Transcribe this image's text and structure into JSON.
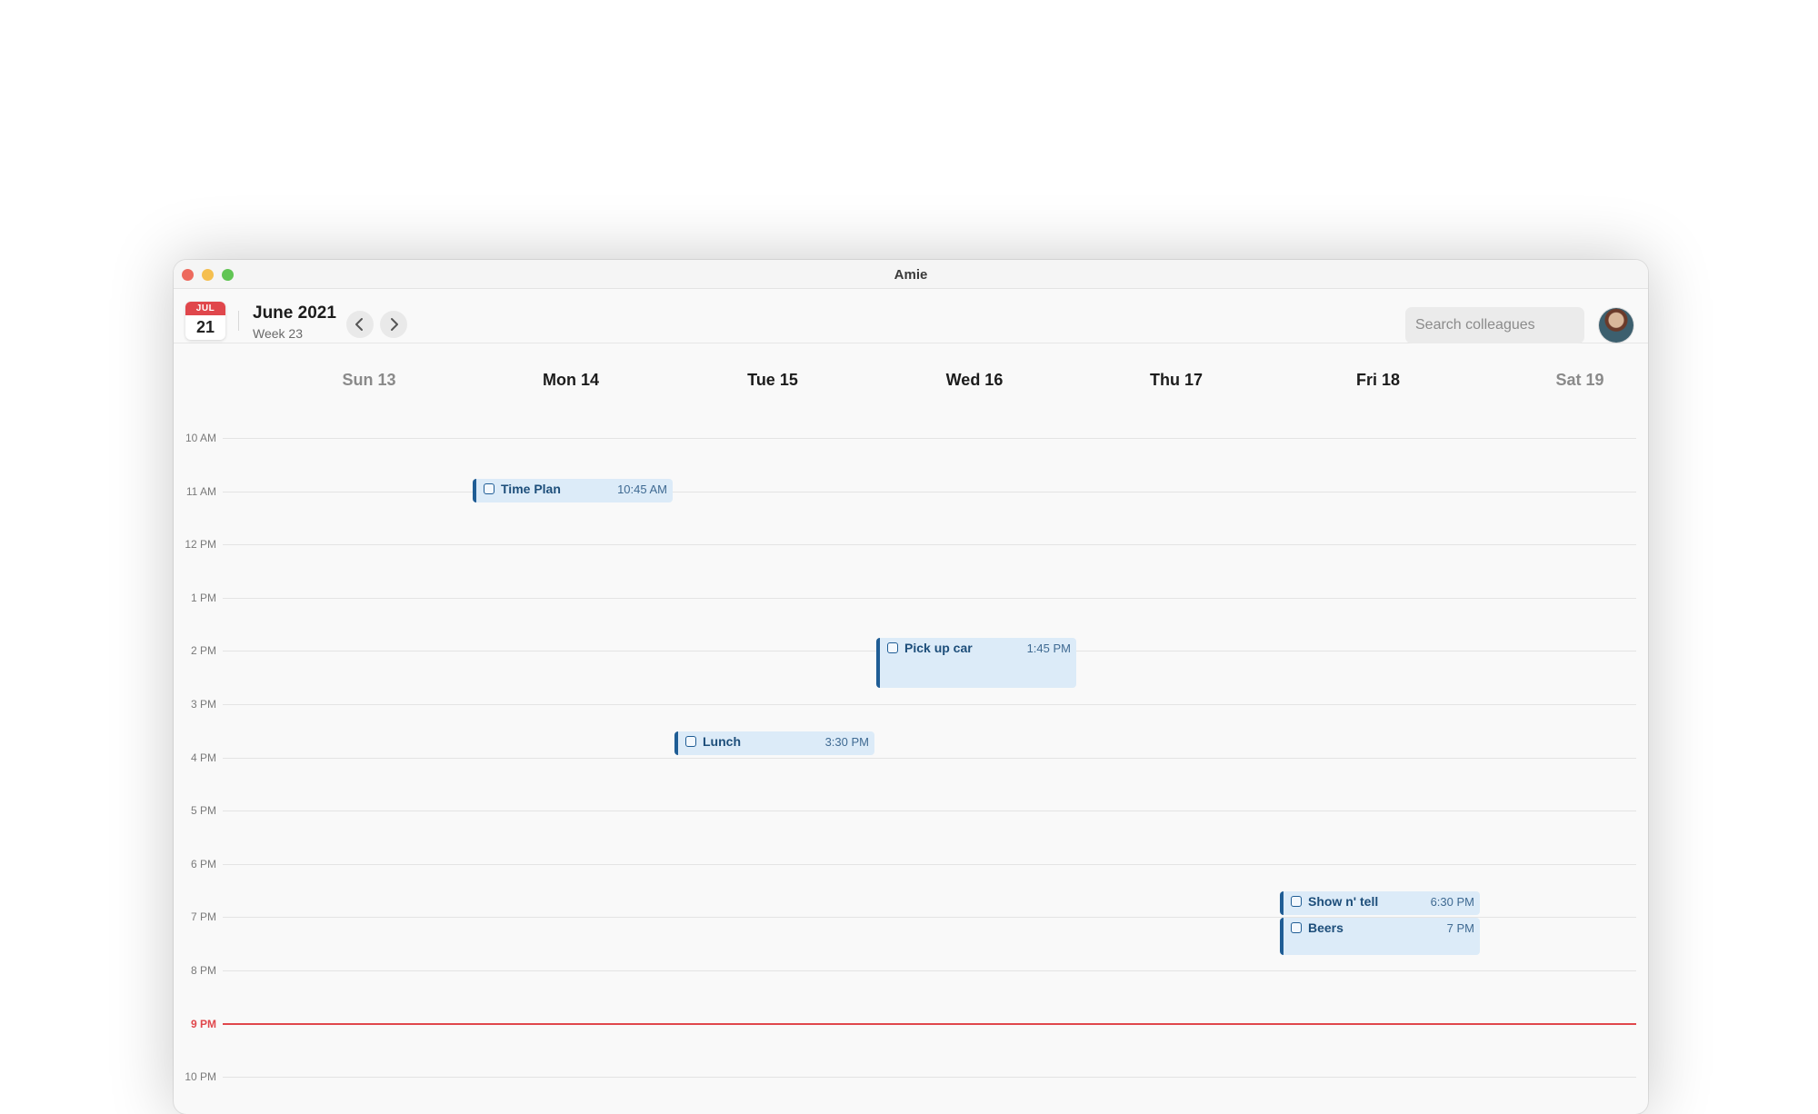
{
  "window": {
    "title": "Amie"
  },
  "toolbar": {
    "date_badge": {
      "month": "JUL",
      "day": "21"
    },
    "month_title": "June 2021",
    "week_label": "Week 23",
    "prev_icon": "chevron-left-icon",
    "next_icon": "chevron-right-icon",
    "search": {
      "placeholder": "Search colleagues",
      "value": ""
    }
  },
  "days": [
    {
      "label": "Sun 13",
      "weekend": true
    },
    {
      "label": "Mon 14",
      "weekend": false
    },
    {
      "label": "Tue 15",
      "weekend": false
    },
    {
      "label": "Wed 16",
      "weekend": false
    },
    {
      "label": "Thu 17",
      "weekend": false
    },
    {
      "label": "Fri 18",
      "weekend": false
    },
    {
      "label": "Sat 19",
      "weekend": true
    }
  ],
  "hours": [
    "10 AM",
    "11 AM",
    "12 PM",
    "1 PM",
    "2 PM",
    "3 PM",
    "4 PM",
    "5 PM",
    "6 PM",
    "7 PM",
    "8 PM",
    "9 PM",
    "10 PM"
  ],
  "current_time_label": "9 PM",
  "events": [
    {
      "title": "Time Plan",
      "time": "10:45 AM",
      "day": "Mon 14"
    },
    {
      "title": "Pick up car",
      "time": "1:45 PM",
      "day": "Wed 16"
    },
    {
      "title": "Lunch",
      "time": "3:30 PM",
      "day": "Tue 15"
    },
    {
      "title": "Show n' tell",
      "time": "6:30 PM",
      "day": "Fri 18"
    },
    {
      "title": "Beers",
      "time": "7 PM",
      "day": "Fri 18"
    }
  ],
  "colors": {
    "accent_red": "#e0474c",
    "event_bg": "#dcebf8",
    "event_bar": "#1f5d95"
  }
}
